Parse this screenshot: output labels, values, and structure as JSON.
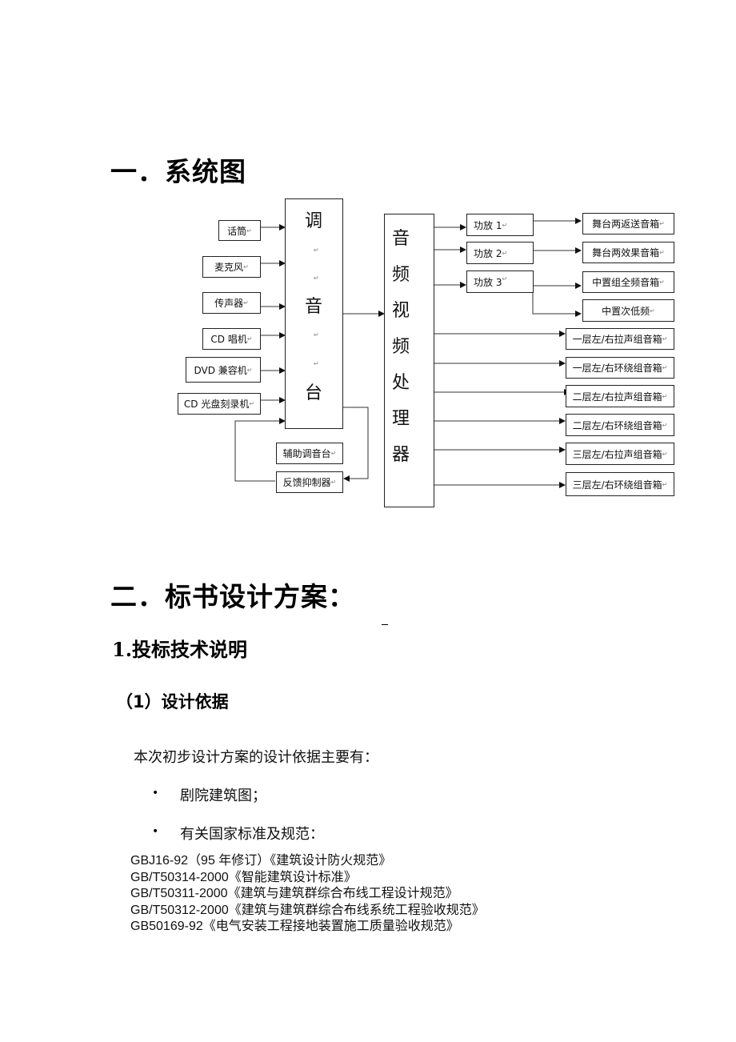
{
  "section1": {
    "heading": "一．系统图"
  },
  "diagram": {
    "inputs": [
      {
        "label": "话筒"
      },
      {
        "label": "麦克风"
      },
      {
        "label": "传声器"
      },
      {
        "label": "CD 唱机"
      },
      {
        "label": "DVD 兼容机"
      },
      {
        "label": "CD 光盘刻录机"
      }
    ],
    "mixer_chars": [
      "调",
      "音",
      "台"
    ],
    "aux_mixer": "辅助调音台",
    "feedback_suppressor": "反馈抑制器",
    "processor_chars": [
      "音",
      "频",
      "视",
      "频",
      "处",
      "理",
      "器"
    ],
    "amplifiers": [
      {
        "label": "功放 1"
      },
      {
        "label": "功放 2"
      },
      {
        "label": "功放 3"
      }
    ],
    "outputs": [
      {
        "label": "舞台两返送音箱"
      },
      {
        "label": "舞台两效果音箱"
      },
      {
        "label": "中置组全频音箱"
      },
      {
        "label": "中置次低频"
      },
      {
        "label": "一层左/右拉声组音箱"
      },
      {
        "label": "一层左/右环绕组音箱"
      },
      {
        "label": "二层左/右拉声组音箱"
      },
      {
        "label": "二层左/右环绕组音箱"
      },
      {
        "label": "三层左/右拉声组音箱"
      },
      {
        "label": "三层左/右环绕组音箱"
      }
    ],
    "paragraph_mark": "↵"
  },
  "section2": {
    "heading": "二．标书设计方案：",
    "subheading": "1.投标技术说明",
    "subsubheading": "（1）设计依据",
    "intro": "本次初步设计方案的设计依据主要有：",
    "bullets": [
      "剧院建筑图；",
      "有关国家标准及规范："
    ],
    "bullet_symbol": "•",
    "standards": [
      "GBJ16-92（95 年修订）《建筑设计防火规范》",
      "GB/T50314-2000《智能建筑设计标准》",
      "GB/T50311-2000《建筑与建筑群综合布线工程设计规范》",
      "GB/T50312-2000《建筑与建筑群综合布线系统工程验收规范》",
      "GB50169-92《电气安装工程接地装置施工质量验收规范》"
    ]
  }
}
